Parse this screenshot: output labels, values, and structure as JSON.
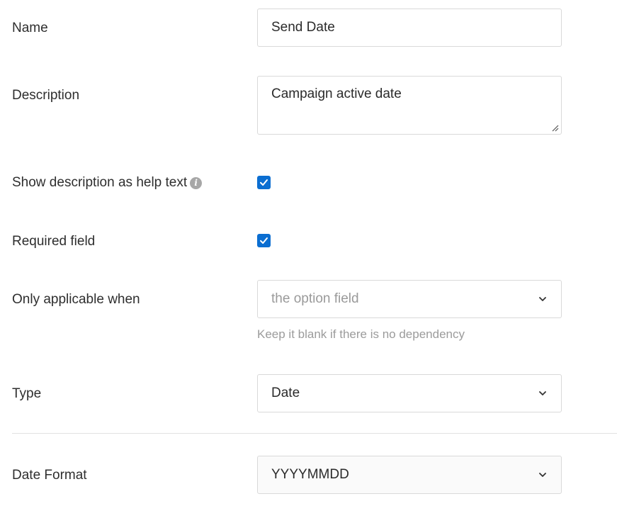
{
  "form": {
    "name": {
      "label": "Name",
      "value": "Send Date"
    },
    "description": {
      "label": "Description",
      "value": "Campaign active date"
    },
    "show_help": {
      "label": "Show description as help text",
      "checked": true,
      "icon": "info-icon"
    },
    "required": {
      "label": "Required field",
      "checked": true
    },
    "applicable_when": {
      "label": "Only applicable when",
      "placeholder": "the option field",
      "hint": "Keep it blank if there is no dependency"
    },
    "type": {
      "label": "Type",
      "value": "Date"
    },
    "date_format": {
      "label": "Date Format",
      "value": "YYYYMMDD"
    }
  },
  "colors": {
    "accent": "#0b6ed1",
    "border": "#d9d9d9",
    "hint_text": "#9b9b9b"
  }
}
